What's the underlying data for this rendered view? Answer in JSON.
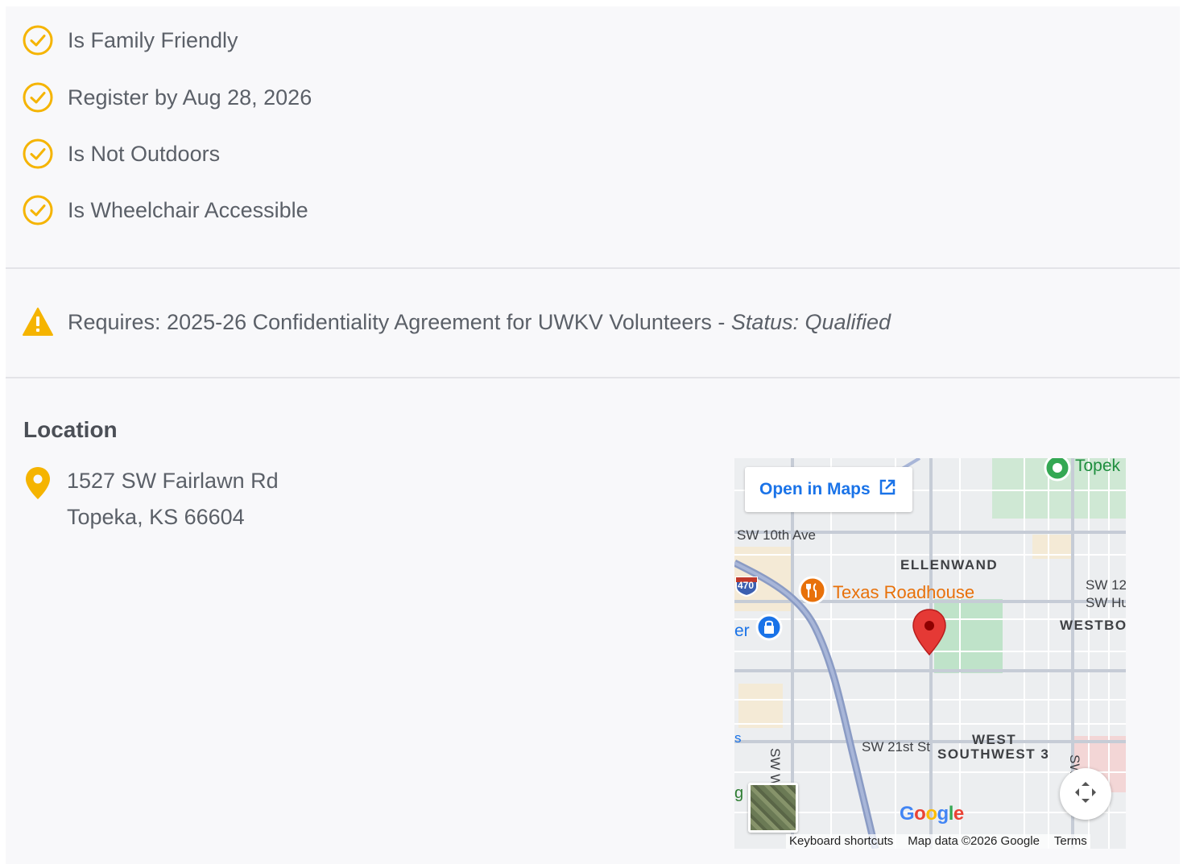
{
  "features": [
    {
      "label": "Is Family Friendly",
      "icon": "check-circle-icon"
    },
    {
      "label": "Register by Aug 28, 2026",
      "icon": "check-circle-icon"
    },
    {
      "label": "Is Not Outdoors",
      "icon": "check-circle-icon"
    },
    {
      "label": "Is Wheelchair Accessible",
      "icon": "check-circle-icon"
    }
  ],
  "requirement": {
    "icon": "warning-icon",
    "text": "Requires: 2025-26 Confidentiality Agreement for UWKV Volunteers - ",
    "status": "Status: Qualified"
  },
  "location": {
    "heading": "Location",
    "icon": "map-pin-icon",
    "line1": "1527 SW Fairlawn Rd",
    "line2": "Topeka, KS  66604"
  },
  "map": {
    "open_label": "Open in Maps",
    "labels": {
      "topeka": "Topek",
      "sw10": "SW 10th Ave",
      "ellenwand": "ELLENWAND",
      "texas": "Texas Roadhouse",
      "sw12": "SW 12",
      "swhu": "SW Hu",
      "westbo": "WESTBO",
      "er": "er",
      "i470": "470",
      "sw21": "SW 21st St",
      "west": "WEST",
      "southwest3": "SOUTHWEST 3",
      "sww": "SW W",
      "swbl": "SW Bl",
      "s_left": "s",
      "g_left": "g"
    },
    "google": "Google",
    "keyboard": "Keyboard shortcuts",
    "mapdata": "Map data ©2026 Google",
    "terms": "Terms"
  },
  "colors": {
    "accent": "#f5b400",
    "link": "#1a73e8",
    "marker": "#e53935",
    "restaurant": "#e8710a"
  }
}
